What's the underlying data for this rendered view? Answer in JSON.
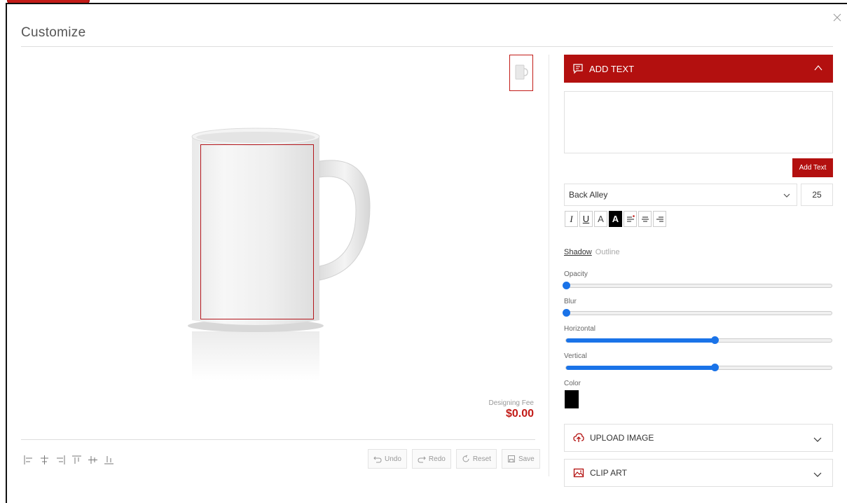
{
  "modal": {
    "title": "Customize",
    "close_label": "×"
  },
  "preview": {
    "designing_fee_label": "Designing Fee",
    "designing_fee_value": "$0.00",
    "actions": {
      "undo": "Undo",
      "redo": "Redo",
      "reset": "Reset",
      "save": "Save"
    },
    "align_tools": [
      "align-left-icon",
      "align-center-vertical-icon",
      "align-right-icon",
      "align-top-icon",
      "align-middle-icon",
      "align-bottom-icon"
    ]
  },
  "panel": {
    "add_text": {
      "header": "ADD TEXT",
      "text_value": "",
      "add_button": "Add Text",
      "font": "Back Alley",
      "font_size": "25",
      "format_buttons": [
        "I",
        "U",
        "A",
        "A"
      ],
      "effect_tabs": {
        "shadow": "Shadow",
        "outline": "Outline"
      },
      "sliders": {
        "opacity": {
          "label": "Opacity",
          "value": 0
        },
        "blur": {
          "label": "Blur",
          "value": 0
        },
        "horizontal": {
          "label": "Horizontal",
          "value": 0.56
        },
        "vertical": {
          "label": "Vertical",
          "value": 0.56
        }
      },
      "color_label": "Color",
      "color_value": "#000000"
    },
    "upload_image": {
      "header": "UPLOAD IMAGE"
    },
    "clip_art": {
      "header": "CLIP ART"
    }
  },
  "colors": {
    "accent": "#b3100f",
    "slider": "#1a73e8"
  }
}
